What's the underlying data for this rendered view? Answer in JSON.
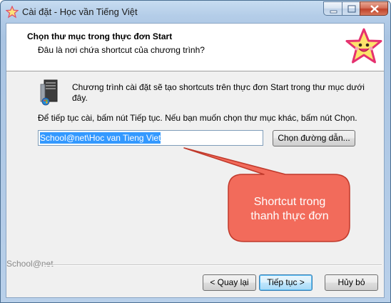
{
  "window": {
    "title": "Cài đặt - Học vần Tiếng Việt",
    "icon": "star-app-icon"
  },
  "header": {
    "title": "Chọn thư mục trong thực đơn Start",
    "subtitle": "Đâu là nơi chứa shortcut của chương trình?"
  },
  "body": {
    "description": "Chương trình cài đặt sẽ tạo shortcuts trên thực đơn Start trong thư mục dưới đây.",
    "instruction": "Để tiếp tục cài, bấm nút Tiếp tục. Nếu bạn muốn chọn thư mục khác, bấm nút Chọn.",
    "folder_value": "School@net\\Hoc van Tieng Viet",
    "browse_label": "Chọn đường dẫn..."
  },
  "footer": {
    "brand": "School@net",
    "back_label": "< Quay lại",
    "next_label": "Tiếp tục >",
    "cancel_label": "Hủy bỏ"
  },
  "callout": {
    "line1": "Shortcut trong",
    "line2": "thanh thực đơn",
    "fill_color": "#f26b5b",
    "border_color": "#c0392b"
  },
  "colors": {
    "selection": "#3399ff",
    "title_bar": "#b9d0ea"
  }
}
